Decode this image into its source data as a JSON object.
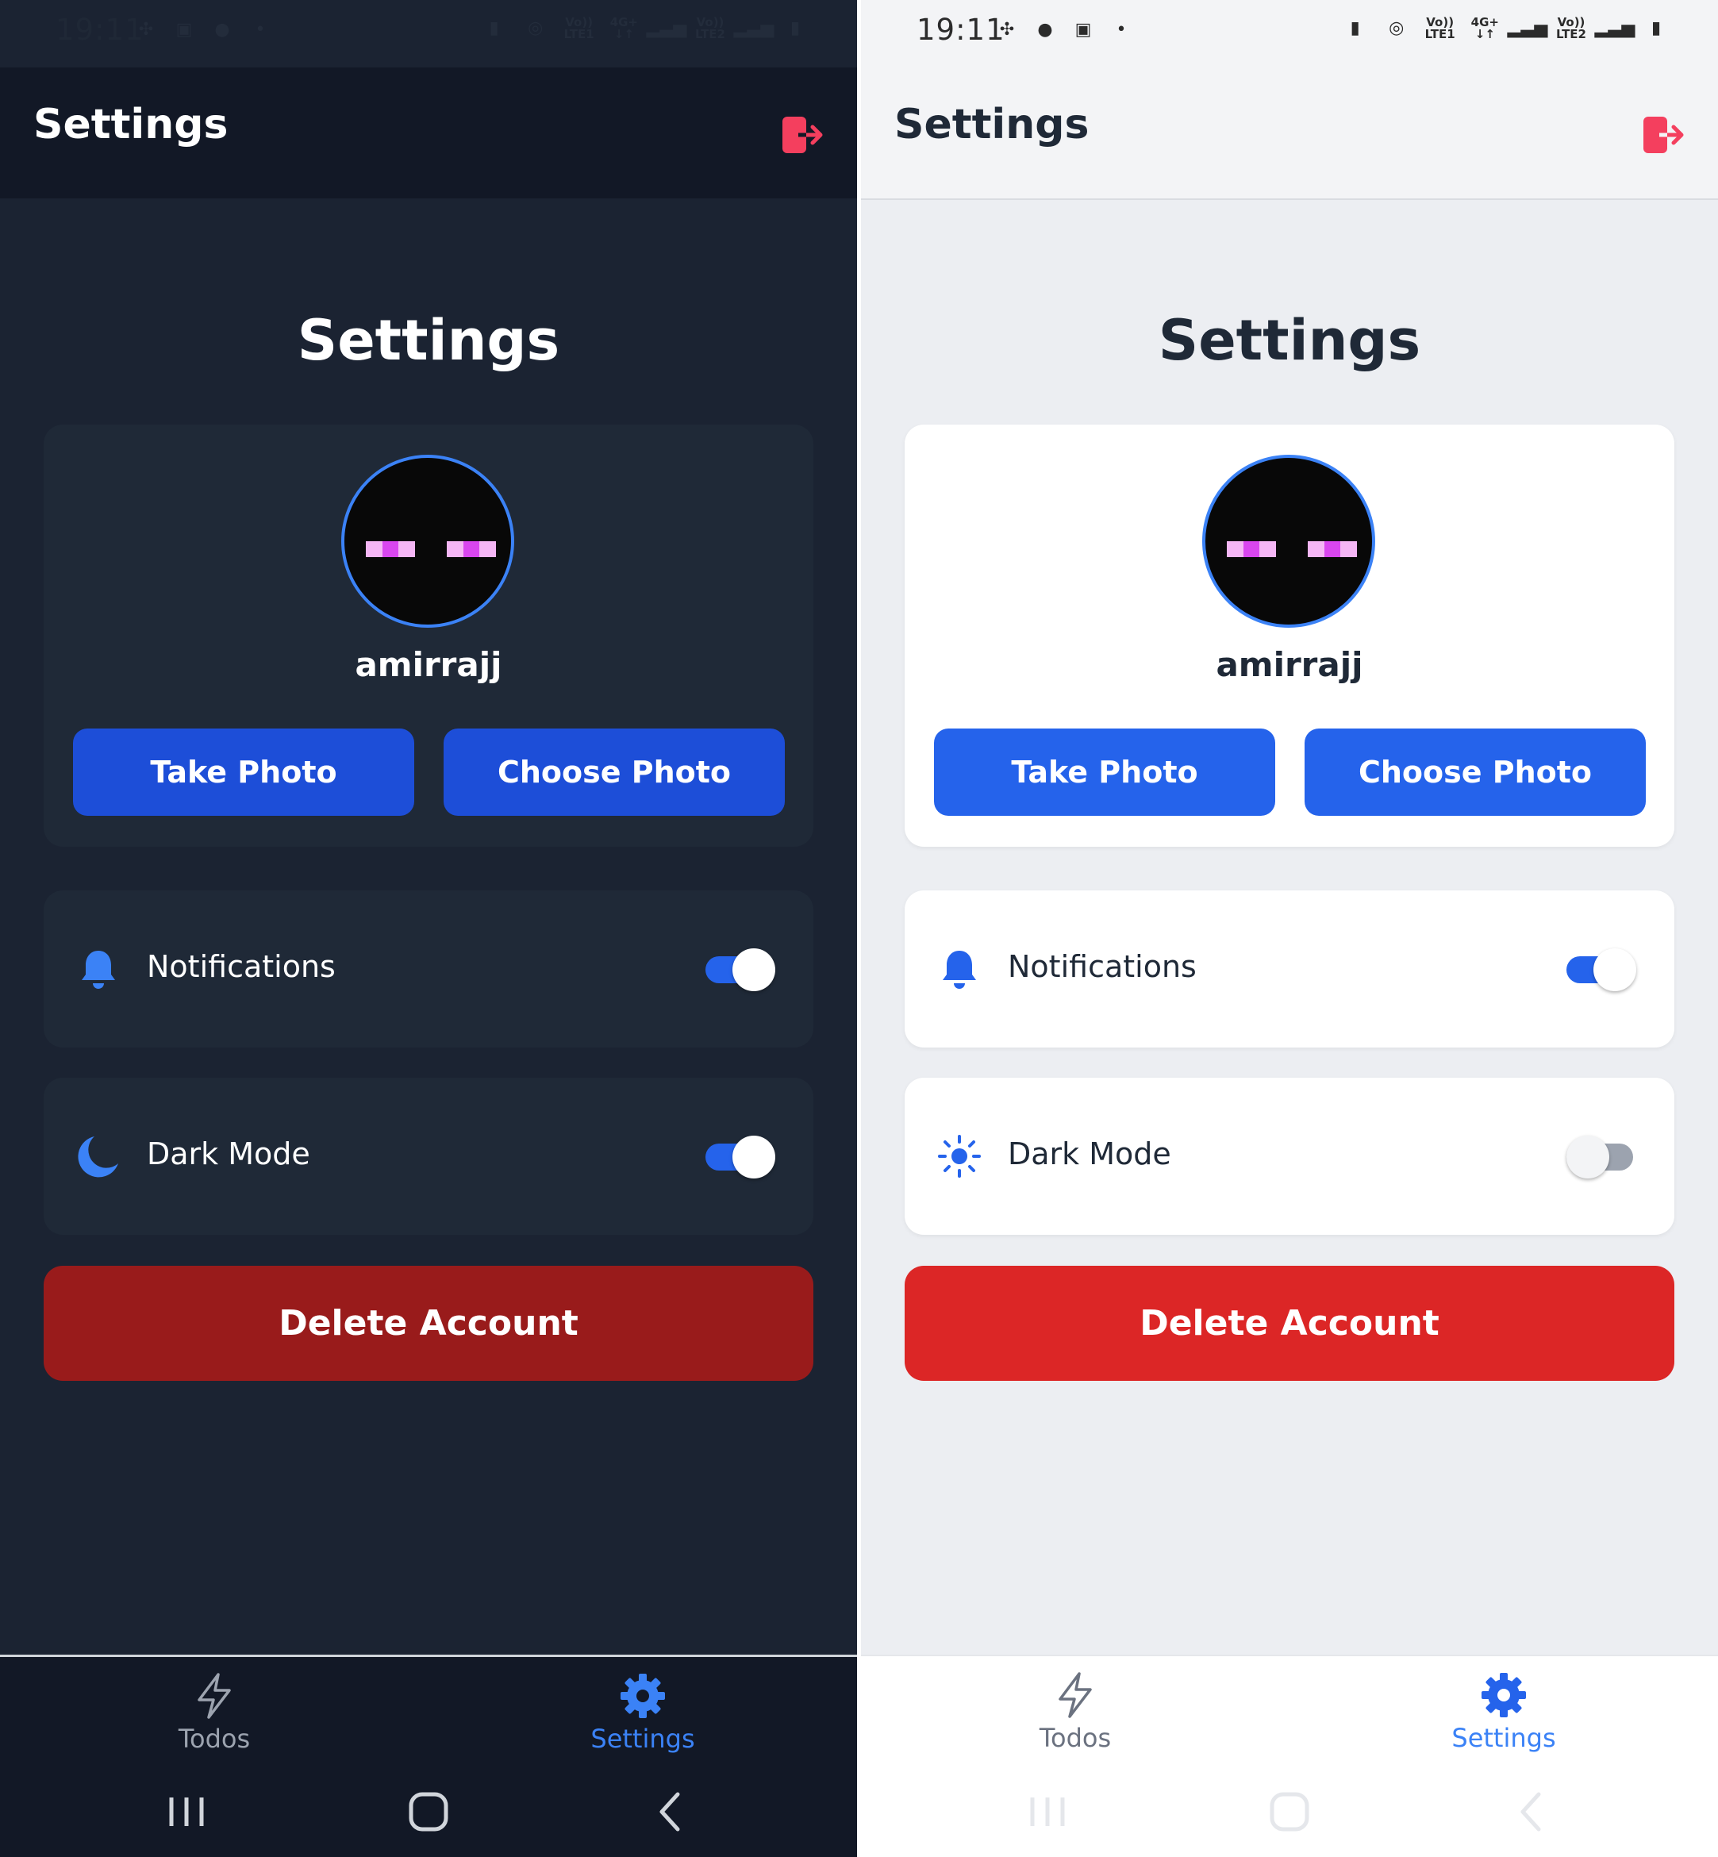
{
  "panels": {
    "dark": {
      "status_bar": {
        "time": "19:11"
      },
      "header": {
        "title": "Settings"
      },
      "page_title": "Settings",
      "profile": {
        "username": "amirrajj",
        "take_photo_label": "Take Photo",
        "choose_photo_label": "Choose Photo"
      },
      "settings": {
        "notifications": {
          "label": "Notifications",
          "enabled": true
        },
        "dark_mode": {
          "label": "Dark Mode",
          "enabled": true
        }
      },
      "delete_account_label": "Delete Account",
      "bottom_nav": [
        {
          "label": "Todos",
          "icon": "bolt-icon",
          "active": false
        },
        {
          "label": "Settings",
          "icon": "gear-icon",
          "active": true
        }
      ]
    },
    "light": {
      "status_bar": {
        "time": "19:11"
      },
      "header": {
        "title": "Settings"
      },
      "page_title": "Settings",
      "profile": {
        "username": "amirrajj",
        "take_photo_label": "Take Photo",
        "choose_photo_label": "Choose Photo"
      },
      "settings": {
        "notifications": {
          "label": "Notifications",
          "enabled": true
        },
        "dark_mode": {
          "label": "Dark Mode",
          "enabled": false
        }
      },
      "delete_account_label": "Delete Account",
      "bottom_nav": [
        {
          "label": "Todos",
          "icon": "bolt-icon",
          "active": false
        },
        {
          "label": "Settings",
          "icon": "gear-icon",
          "active": true
        }
      ]
    }
  },
  "status_bar_network": {
    "sim1_line1": "Vo))",
    "sim1_line2": "LTE1",
    "data_line1": "4G+",
    "sim2_line1": "Vo))",
    "sim2_line2": "LTE2"
  },
  "colors": {
    "accent_blue": "#2563eb",
    "danger_red": "#dc2626",
    "danger_red_dark": "#991b1b",
    "logout_red": "#f43f5e",
    "dark_bg": "#1b2332",
    "light_bg": "#eceef2"
  }
}
